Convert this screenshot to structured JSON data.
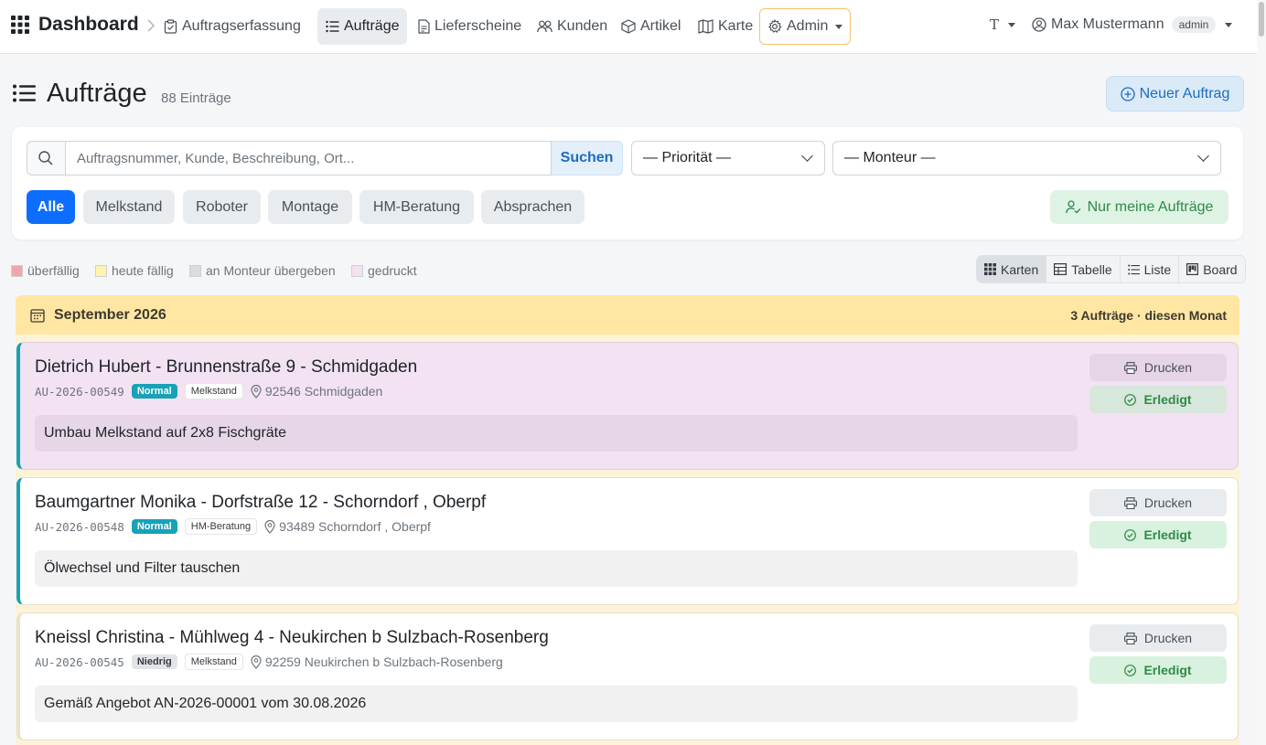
{
  "navbar": {
    "brand": "Dashboard",
    "links": [
      {
        "label": "Auftragserfassung"
      },
      {
        "label": "Aufträge"
      },
      {
        "label": "Lieferscheine"
      },
      {
        "label": "Kunden"
      },
      {
        "label": "Artikel"
      },
      {
        "label": "Karte"
      },
      {
        "label": "Admin"
      }
    ],
    "font_toggle": "T",
    "user_name": "Max Mustermann",
    "user_role": "admin"
  },
  "page": {
    "title": "Aufträge",
    "count": "88 Einträge",
    "new_button": "Neuer Auftrag"
  },
  "filters": {
    "search_placeholder": "Auftragsnummer, Kunde, Beschreibung, Ort...",
    "search_button": "Suchen",
    "priority_select": "— Priorität —",
    "monteur_select": "— Monteur —",
    "categories": [
      {
        "label": "Alle"
      },
      {
        "label": "Melkstand"
      },
      {
        "label": "Roboter"
      },
      {
        "label": "Montage"
      },
      {
        "label": "HM-Beratung"
      },
      {
        "label": "Absprachen"
      }
    ],
    "mine_button": "Nur meine Aufträge"
  },
  "legend": [
    {
      "label": "überfällig",
      "color": "#f1a6ad"
    },
    {
      "label": "heute fällig",
      "color": "#fff3b0"
    },
    {
      "label": "an Monteur übergeben",
      "color": "#dcdcdc"
    },
    {
      "label": "gedruckt",
      "color": "#f2e2f2"
    }
  ],
  "views": [
    {
      "label": "Karten"
    },
    {
      "label": "Tabelle"
    },
    {
      "label": "Liste"
    },
    {
      "label": "Board"
    }
  ],
  "month_group": {
    "label": "September 2026",
    "meta": "3 Aufträge · diesen Monat"
  },
  "orders": [
    {
      "title": "Dietrich Hubert - Brunnenstraße 9 - Schmidgaden",
      "number": "AU-2026-00549",
      "priority": "Normal",
      "category": "Melkstand",
      "location": "92546 Schmidgaden",
      "description": "Umbau Melkstand auf 2x8 Fischgräte",
      "print_label": "Drucken",
      "done_label": "Erledigt"
    },
    {
      "title": "Baumgartner Monika - Dorfstraße 12 - Schorndorf , Oberpf",
      "number": "AU-2026-00548",
      "priority": "Normal",
      "category": "HM-Beratung",
      "location": "93489 Schorndorf , Oberpf",
      "description": "Ölwechsel und Filter tauschen",
      "print_label": "Drucken",
      "done_label": "Erledigt"
    },
    {
      "title": "Kneissl Christina - Mühlweg 4 - Neukirchen b Sulzbach-Rosenberg",
      "number": "AU-2026-00545",
      "priority": "Niedrig",
      "category": "Melkstand",
      "location": "92259 Neukirchen b Sulzbach-Rosenberg",
      "description": "Gemäß Angebot AN-2026-00001 vom 30.08.2026",
      "print_label": "Drucken",
      "done_label": "Erledigt"
    }
  ],
  "colors": {
    "primary": "#0d6efd",
    "accent_teal": "#17a2b8",
    "success_text": "#2f8a47",
    "month_header": "#ffe6a3",
    "printed_card": "#f2e2f2"
  },
  "icons": [
    "apps-grid-icon",
    "clipboard-icon",
    "list-icon",
    "document-icon",
    "users-icon",
    "box-icon",
    "map-icon",
    "gear-icon",
    "user-circle-icon",
    "search-icon",
    "plus-circle-icon",
    "user-check-icon",
    "calendar-icon",
    "printer-icon",
    "check-circle-icon",
    "map-pin-icon",
    "table-icon",
    "board-icon"
  ]
}
